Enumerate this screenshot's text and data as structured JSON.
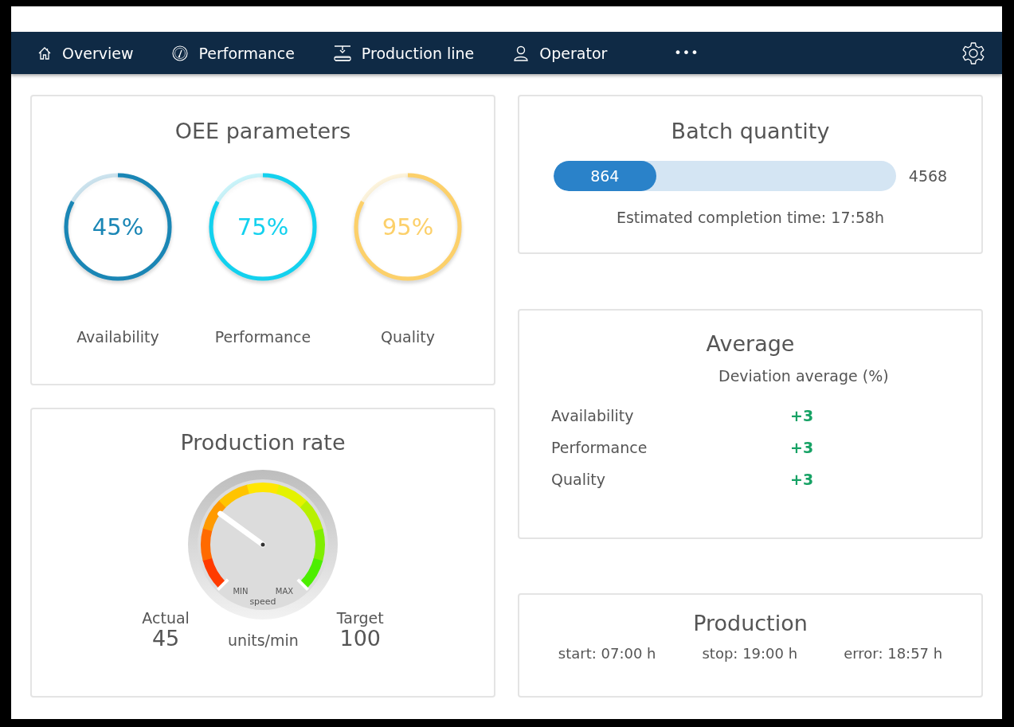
{
  "nav": {
    "items": [
      {
        "label": "Overview"
      },
      {
        "label": "Performance"
      },
      {
        "label": "Production line"
      },
      {
        "label": "Operator"
      }
    ],
    "more": "•••"
  },
  "oee": {
    "title": "OEE parameters",
    "rings": [
      {
        "value": "45%",
        "label": "Availability",
        "level": 0.83,
        "color": "#1a86b5"
      },
      {
        "value": "75%",
        "label": "Performance",
        "level": 0.83,
        "color": "#13d1ee"
      },
      {
        "value": "95%",
        "label": "Quality",
        "level": 0.83,
        "color": "#fcd06a"
      }
    ]
  },
  "production_rate": {
    "title": "Production rate",
    "gauge": {
      "min": "MIN",
      "max": "MAX",
      "caption": "speed"
    },
    "actual_label": "Actual",
    "actual": "45",
    "unit": "units/min",
    "target_label": "Target",
    "target": "100"
  },
  "batch": {
    "title": "Batch quantity",
    "done": "864",
    "total": "4568",
    "level": 0.3,
    "estimate": "Estimated completion time: 17:58h"
  },
  "average": {
    "title": "Average",
    "header": "Deviation average  (%)",
    "rows": [
      {
        "label": "Availability",
        "value": "+3"
      },
      {
        "label": "Performance",
        "value": "+3"
      },
      {
        "label": "Quality",
        "value": "+3"
      }
    ]
  },
  "production": {
    "title": "Production",
    "times": [
      "start: 07:00 h",
      "stop: 19:00 h",
      "error: 18:57 h"
    ]
  }
}
